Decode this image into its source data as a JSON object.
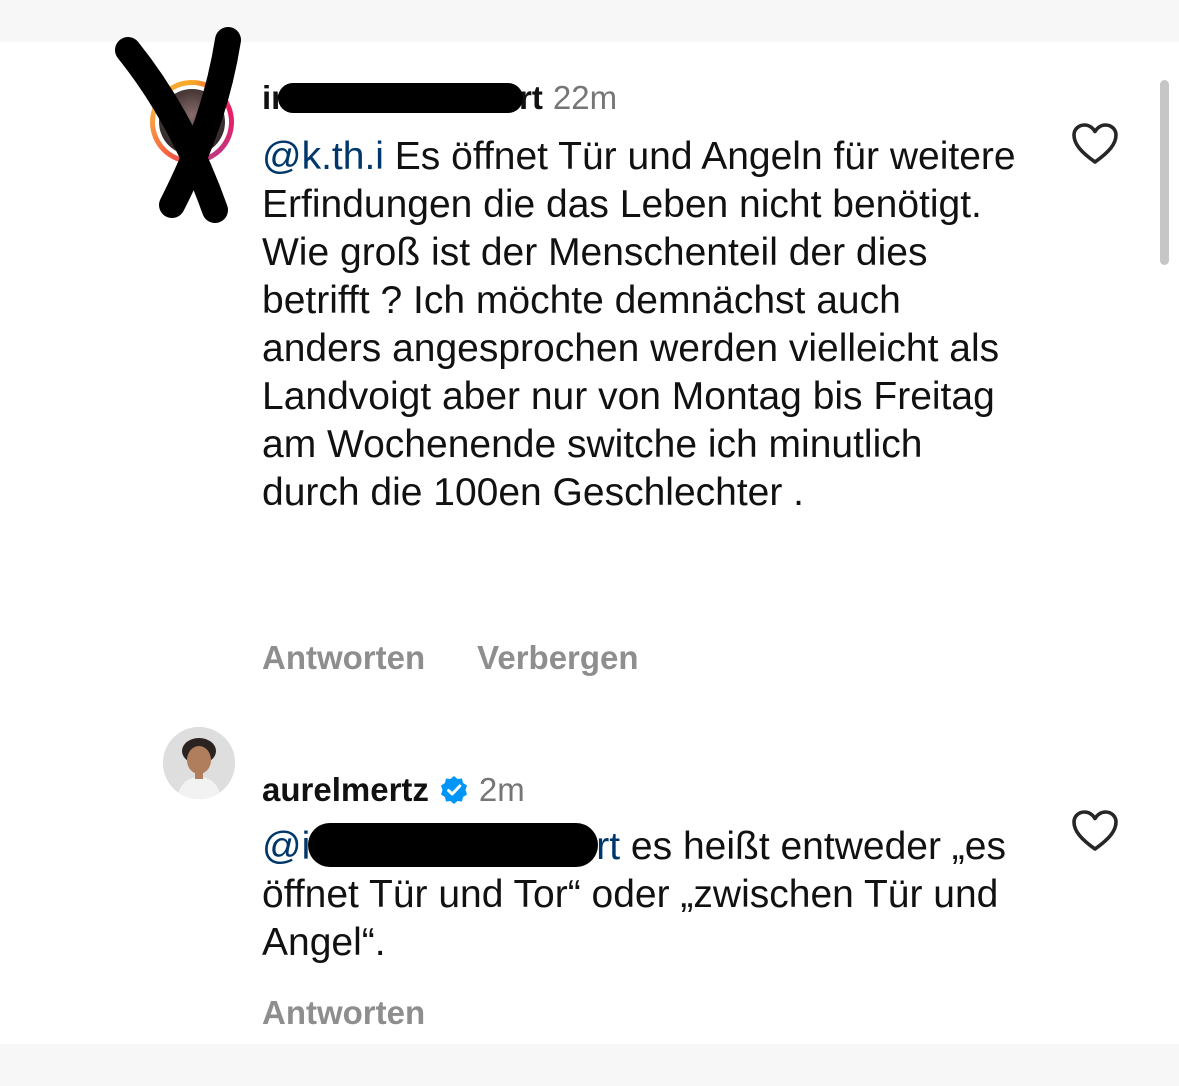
{
  "comments": [
    {
      "username_visible": "ir",
      "username_tail": "rt",
      "time": "22m",
      "mention": "@k.th.i",
      "text": " Es öffnet Tür und Angeln für weitere Erfindungen die das Leben nicht benötigt. Wie groß ist der Menschenteil der dies betrifft ? Ich möchte demnächst auch anders angesprochen werden vielleicht als Landvoigt aber nur von Montag bis Freitag am Wochenende switche ich minutlich durch die 100en Geschlechter .",
      "actions": [
        "Antworten",
        "Verbergen"
      ],
      "liked": false
    },
    {
      "username": "aurelmertz",
      "verified": true,
      "time": "2m",
      "mention_start": "@i",
      "mention_end": "rt",
      "text": " es heißt entweder „es öffnet Tür und Tor“ oder „zwischen Tür und Angel“.",
      "actions": [
        "Antworten"
      ],
      "liked": false
    }
  ],
  "icons": {
    "like": "heart-outline-icon",
    "verified": "verified-badge-icon"
  },
  "colors": {
    "mention": "#00376b",
    "secondary_text": "#8e8e8e",
    "verified_blue": "#0095f6"
  }
}
